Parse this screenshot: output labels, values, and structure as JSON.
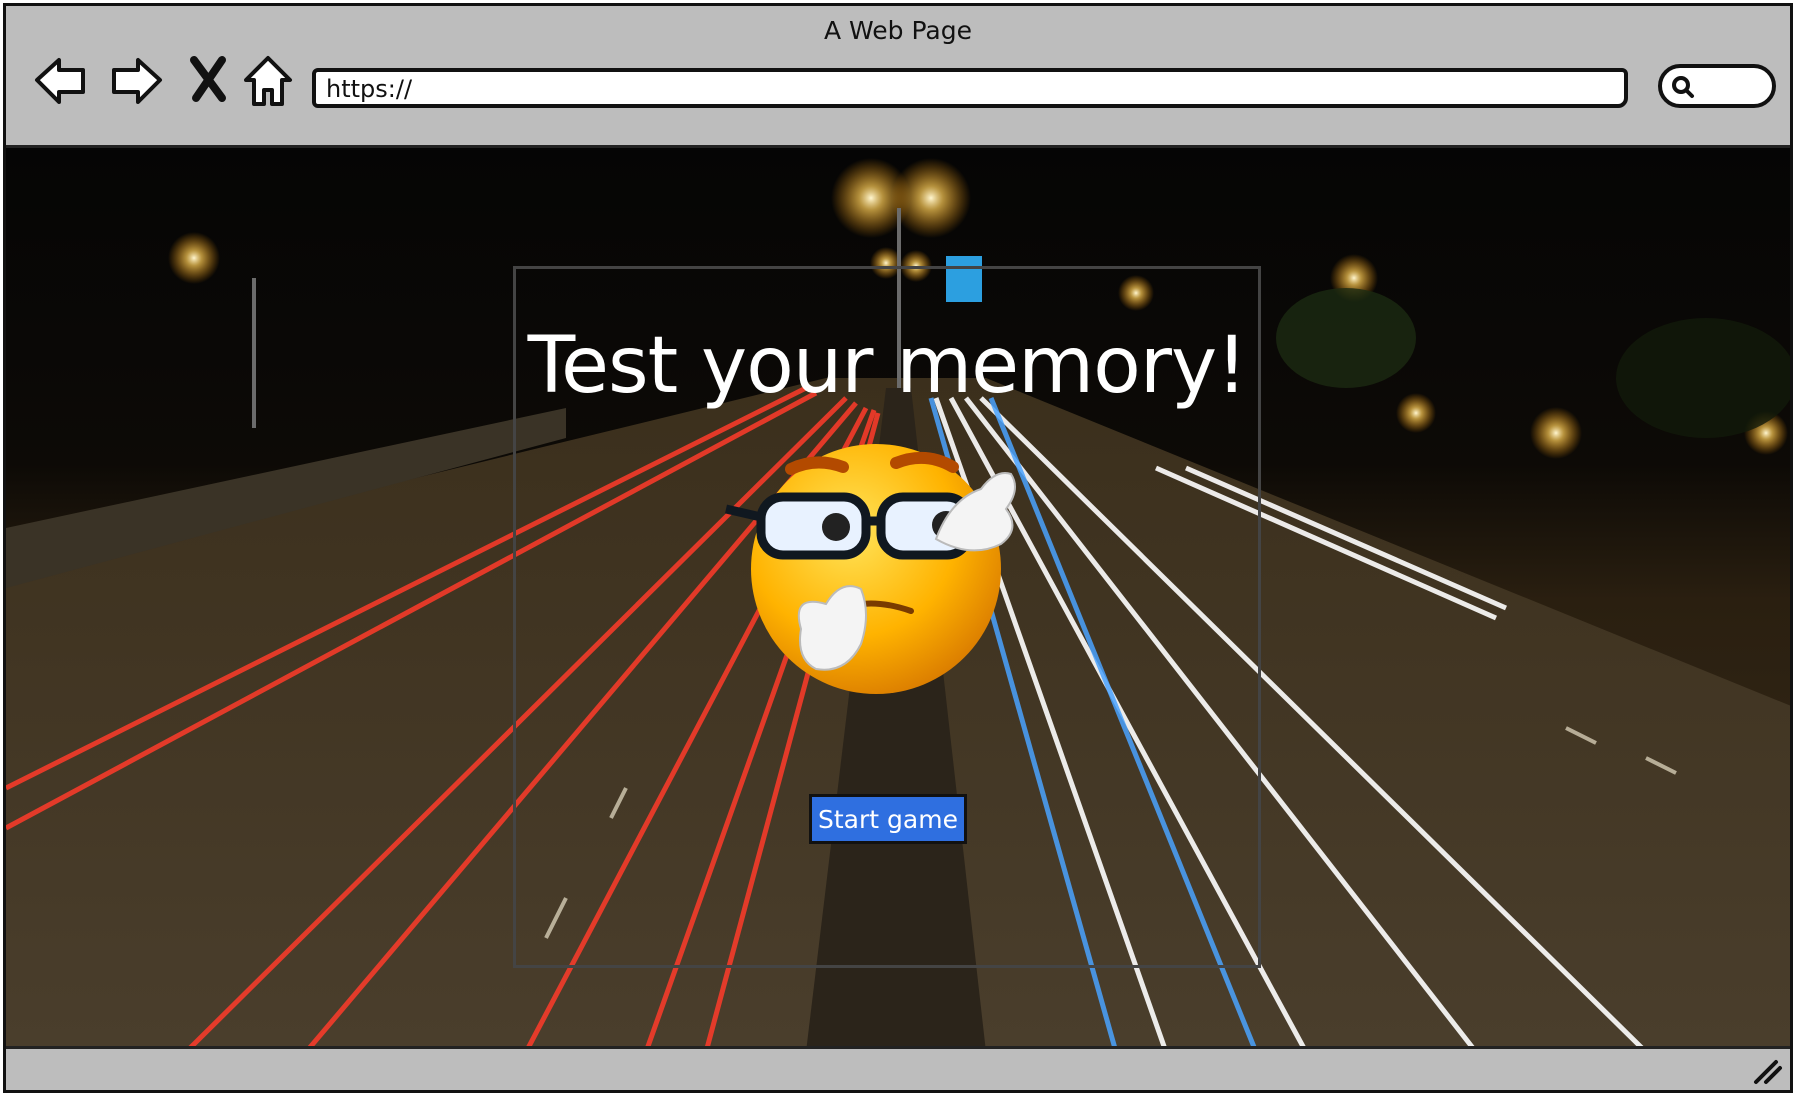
{
  "window": {
    "title": "A Web Page"
  },
  "toolbar": {
    "back_icon": "back-arrow-icon",
    "forward_icon": "forward-arrow-icon",
    "stop_icon": "close-icon",
    "home_icon": "home-icon",
    "url": "https://",
    "search_icon": "search-icon"
  },
  "page": {
    "headline": "Test your memory!",
    "start_button": "Start game",
    "hero_icon": "thinking-emoji-with-glasses",
    "background_image": "night highway with light trails"
  },
  "colors": {
    "chrome": "#bdbdbd",
    "button": "#2f6fe0",
    "headline": "#ffffff"
  }
}
